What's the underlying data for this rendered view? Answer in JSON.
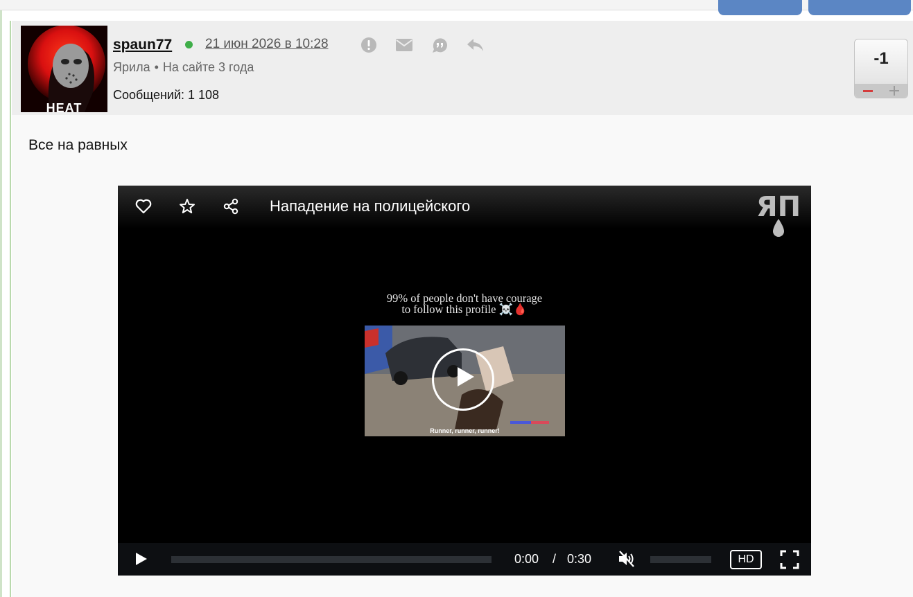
{
  "post": {
    "author": {
      "username": "spaun77",
      "status_color": "#3fae49",
      "rank": "Ярила",
      "meta_separator": "•",
      "tenure": "На сайте 3 года",
      "posts_count": "Сообщений: 1 108",
      "avatar_text": "HEAT"
    },
    "date": "21 июн 2026 в 10:28",
    "actions": [
      "report-icon",
      "mail-icon",
      "quote-icon",
      "reply-icon"
    ],
    "rating": {
      "value": "-1",
      "minus_color": "#d43c3c"
    },
    "text": "Все на равных"
  },
  "video": {
    "title": "Нападение на полицейского",
    "top_icons": [
      "heart-icon",
      "star-icon",
      "share-icon"
    ],
    "watermark": "ЯП",
    "caption_line1": "99% of people don't have courage",
    "caption_line2": "to follow this profile ☠️🩸",
    "thumbnail_subtitle": "Runner, runner, runner!",
    "controls": {
      "current_time": "0:00",
      "time_separator": "/",
      "duration": "0:30",
      "progress": 0,
      "quality": "HD",
      "muted": true
    }
  }
}
